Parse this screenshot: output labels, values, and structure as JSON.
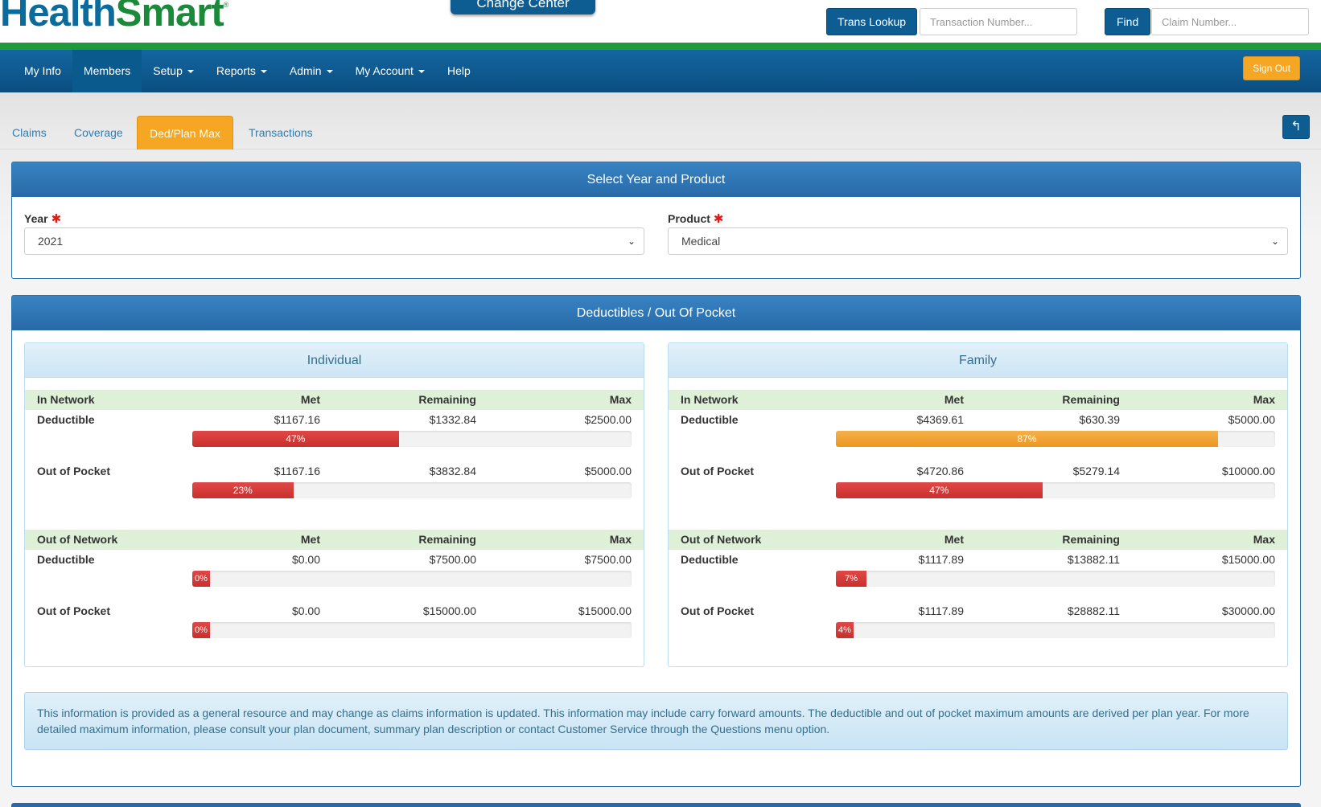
{
  "header": {
    "logo_part1": "H",
    "logo_part2": "ealth",
    "logo_part3": "Smart",
    "logo_reg": "®",
    "change_center": "Change Center",
    "trans_lookup_label": "Trans Lookup",
    "transaction_placeholder": "Transaction Number...",
    "find_label": "Find",
    "claim_placeholder": "Claim Number..."
  },
  "nav": {
    "items": [
      {
        "label": "My Info",
        "dropdown": false
      },
      {
        "label": "Members",
        "dropdown": false
      },
      {
        "label": "Setup",
        "dropdown": true
      },
      {
        "label": "Reports",
        "dropdown": true
      },
      {
        "label": "Admin",
        "dropdown": true
      },
      {
        "label": "My Account",
        "dropdown": true
      },
      {
        "label": "Help",
        "dropdown": false
      }
    ],
    "active": "Members",
    "sign_out": "Sign Out"
  },
  "tabs": {
    "items": [
      "Claims",
      "Coverage",
      "Ded/Plan Max",
      "Transactions"
    ],
    "active": "Ded/Plan Max",
    "back_icon": "undo-arrow-icon"
  },
  "select_panel": {
    "title": "Select Year and Product",
    "year_label": "Year",
    "year_value": "2021",
    "product_label": "Product",
    "product_value": "Medical",
    "required_mark": "✱"
  },
  "deductibles": {
    "title": "Deductibles / Out Of Pocket",
    "columns": {
      "met": "Met",
      "remaining": "Remaining",
      "max": "Max"
    },
    "individual": {
      "title": "Individual",
      "in_network": {
        "label": "In Network",
        "deductible": {
          "label": "Deductible",
          "met": "$1167.16",
          "remaining": "$1332.84",
          "max": "$2500.00",
          "percent": 47,
          "percent_label": "47%"
        },
        "out_of_pocket": {
          "label": "Out of Pocket",
          "met": "$1167.16",
          "remaining": "$3832.84",
          "max": "$5000.00",
          "percent": 23,
          "percent_label": "23%"
        }
      },
      "out_network": {
        "label": "Out of Network",
        "deductible": {
          "label": "Deductible",
          "met": "$0.00",
          "remaining": "$7500.00",
          "max": "$7500.00",
          "percent": 0,
          "percent_label": "0%"
        },
        "out_of_pocket": {
          "label": "Out of Pocket",
          "met": "$0.00",
          "remaining": "$15000.00",
          "max": "$15000.00",
          "percent": 0,
          "percent_label": "0%"
        }
      }
    },
    "family": {
      "title": "Family",
      "in_network": {
        "label": "In Network",
        "deductible": {
          "label": "Deductible",
          "met": "$4369.61",
          "remaining": "$630.39",
          "max": "$5000.00",
          "percent": 87,
          "percent_label": "87%"
        },
        "out_of_pocket": {
          "label": "Out of Pocket",
          "met": "$4720.86",
          "remaining": "$5279.14",
          "max": "$10000.00",
          "percent": 47,
          "percent_label": "47%"
        }
      },
      "out_network": {
        "label": "Out of Network",
        "deductible": {
          "label": "Deductible",
          "met": "$1117.89",
          "remaining": "$13882.11",
          "max": "$15000.00",
          "percent": 7,
          "percent_label": "7%"
        },
        "out_of_pocket": {
          "label": "Out of Pocket",
          "met": "$1117.89",
          "remaining": "$28882.11",
          "max": "$30000.00",
          "percent": 4,
          "percent_label": "4%"
        }
      }
    },
    "note": "This information is provided as a general resource and may change as claims information is updated. This information may include carry forward amounts. The deductible and out of pocket maximum amounts are derived per plan year. For more detailed maximum information, please consult your plan document, summary plan description or contact Customer Service through the Questions menu option."
  },
  "colors": {
    "brand_blue": "#0d5d92",
    "brand_green": "#1a8a3a",
    "accent_orange": "#f5a623",
    "bar_red": "#c9302c",
    "bar_orange": "#ec971f"
  }
}
